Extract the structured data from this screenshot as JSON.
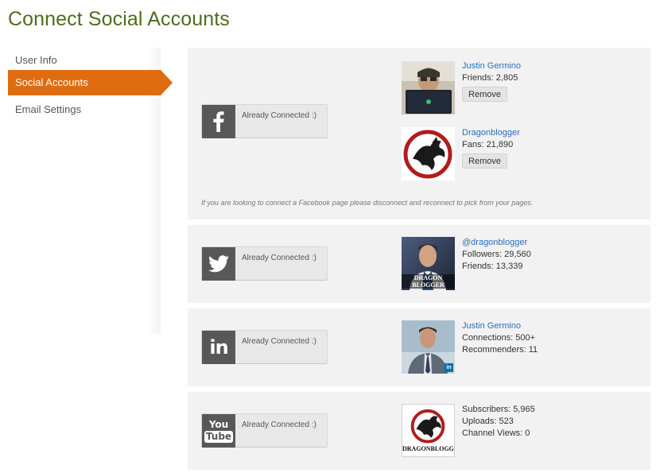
{
  "page": {
    "title": "Connect Social Accounts"
  },
  "sidebar": {
    "items": [
      {
        "label": "User Info",
        "active": false
      },
      {
        "label": "Social Accounts",
        "active": true
      },
      {
        "label": "Email Settings",
        "active": false
      }
    ],
    "accent_color": "#e06c10"
  },
  "facebook": {
    "icon": "facebook-icon",
    "status": "Already Connected :)",
    "accounts": [
      {
        "name": "Justin Germino",
        "stat": "Friends: 2,805",
        "remove_label": "Remove"
      },
      {
        "name": "Dragonblogger",
        "stat": "Fans: 21,890",
        "remove_label": "Remove"
      }
    ],
    "note": "If you are looking to connect a Facebook page please disconnect and reconnect to pick from your pages."
  },
  "twitter": {
    "icon": "twitter-icon",
    "status": "Already Connected :)",
    "account": {
      "name": "@dragonblogger",
      "stat1": "Followers: 29,560",
      "stat2": "Friends: 13,339"
    },
    "avatar_caption": "DRAGON BLOGGER"
  },
  "linkedin": {
    "icon": "linkedin-icon",
    "status": "Already Connected :)",
    "icon_text": "in",
    "account": {
      "name": "Justin Germino",
      "stat1": "Connections: 500+",
      "stat2": "Recommenders: 11"
    },
    "badge_text": "in"
  },
  "youtube": {
    "icon": "youtube-icon",
    "status": "Already Connected :)",
    "icon_text_top": "You",
    "icon_text_bottom": "Tube",
    "account": {
      "stat1": "Subscribers: 5,965",
      "stat2": "Uploads: 523",
      "stat3": "Channel Views: 0"
    },
    "avatar_caption": "DRAGONBLOGGER"
  }
}
